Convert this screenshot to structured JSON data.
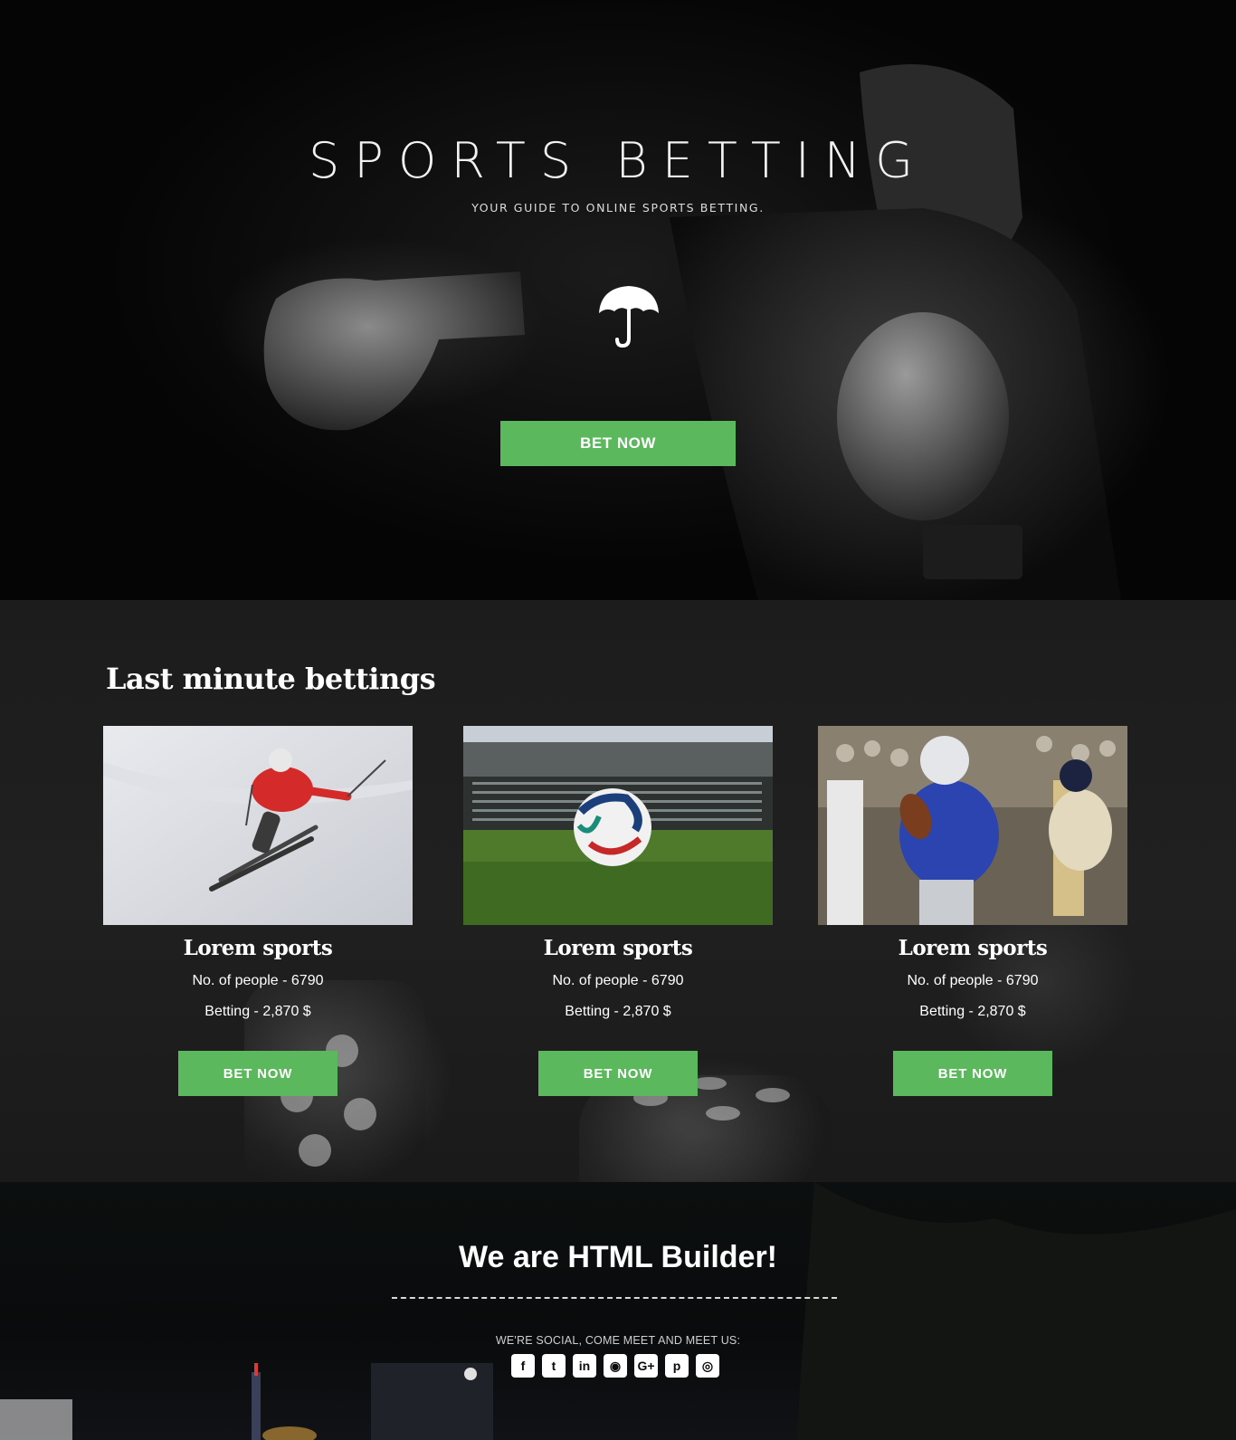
{
  "hero": {
    "title": "SPORTS BETTING",
    "subtitle": "YOUR GUIDE TO ONLINE SPORTS BETTING.",
    "cta": "BET NOW",
    "icon": "umbrella-icon"
  },
  "bettings": {
    "title": "Last minute bettings",
    "cards": [
      {
        "image": "skier-photo",
        "title": "Lorem sports",
        "people": "No. of people - 6790",
        "betting": "Betting - 2,870 $",
        "cta": "BET NOW"
      },
      {
        "image": "soccer-ball-stadium-photo",
        "title": "Lorem sports",
        "people": "No. of people - 6790",
        "betting": "Betting - 2,870 $",
        "cta": "BET NOW"
      },
      {
        "image": "american-football-photo",
        "title": "Lorem sports",
        "people": "No. of people - 6790",
        "betting": "Betting - 2,870 $",
        "cta": "BET NOW"
      }
    ]
  },
  "footer": {
    "title": "We are HTML Builder!",
    "subtitle": "WE'RE SOCIAL, COME MEET AND MEET US:",
    "socials": [
      {
        "icon": "facebook-icon",
        "glyph": "f"
      },
      {
        "icon": "twitter-icon",
        "glyph": "t"
      },
      {
        "icon": "linkedin-icon",
        "glyph": "in"
      },
      {
        "icon": "github-icon",
        "glyph": "◉"
      },
      {
        "icon": "google-plus-icon",
        "glyph": "G+"
      },
      {
        "icon": "pinterest-icon",
        "glyph": "p"
      },
      {
        "icon": "instagram-icon",
        "glyph": "◎"
      }
    ]
  },
  "colors": {
    "accent": "#5cb85c",
    "hero_bg": "#0a0a0a",
    "section_bg": "#1e1e1e"
  }
}
